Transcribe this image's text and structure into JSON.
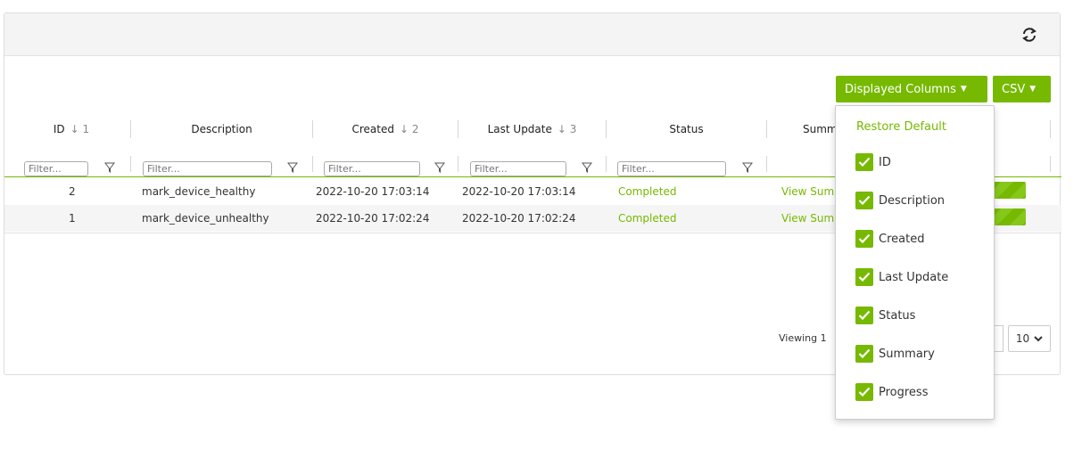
{
  "toolbar": {
    "displayed_columns_label": "Displayed Columns",
    "csv_label": "CSV",
    "refresh_icon": "refresh-icon"
  },
  "columns": [
    {
      "label": "ID",
      "sort": "↓ 1"
    },
    {
      "label": "Description",
      "sort": ""
    },
    {
      "label": "Created",
      "sort": "↓ 2"
    },
    {
      "label": "Last Update",
      "sort": "↓ 3"
    },
    {
      "label": "Status",
      "sort": ""
    },
    {
      "label": "Summa",
      "sort": ""
    }
  ],
  "filter_placeholder": "Filter...",
  "rows": [
    {
      "id": "2",
      "description": "mark_device_healthy",
      "created": "2022-10-20 17:03:14",
      "last_update": "2022-10-20 17:03:14",
      "status": "Completed",
      "summary": "View Sum",
      "progress": 1.0
    },
    {
      "id": "1",
      "description": "mark_device_unhealthy",
      "created": "2022-10-20 17:02:24",
      "last_update": "2022-10-20 17:02:24",
      "status": "Completed",
      "summary": "View Sum",
      "progress": 1.0
    }
  ],
  "footer": {
    "viewing": "Viewing 1",
    "page_size": "10"
  },
  "menu": {
    "restore_default": "Restore Default",
    "items": [
      "ID",
      "Description",
      "Created",
      "Last Update",
      "Status",
      "Summary",
      "Progress"
    ]
  },
  "colors": {
    "accent": "#76b900"
  }
}
